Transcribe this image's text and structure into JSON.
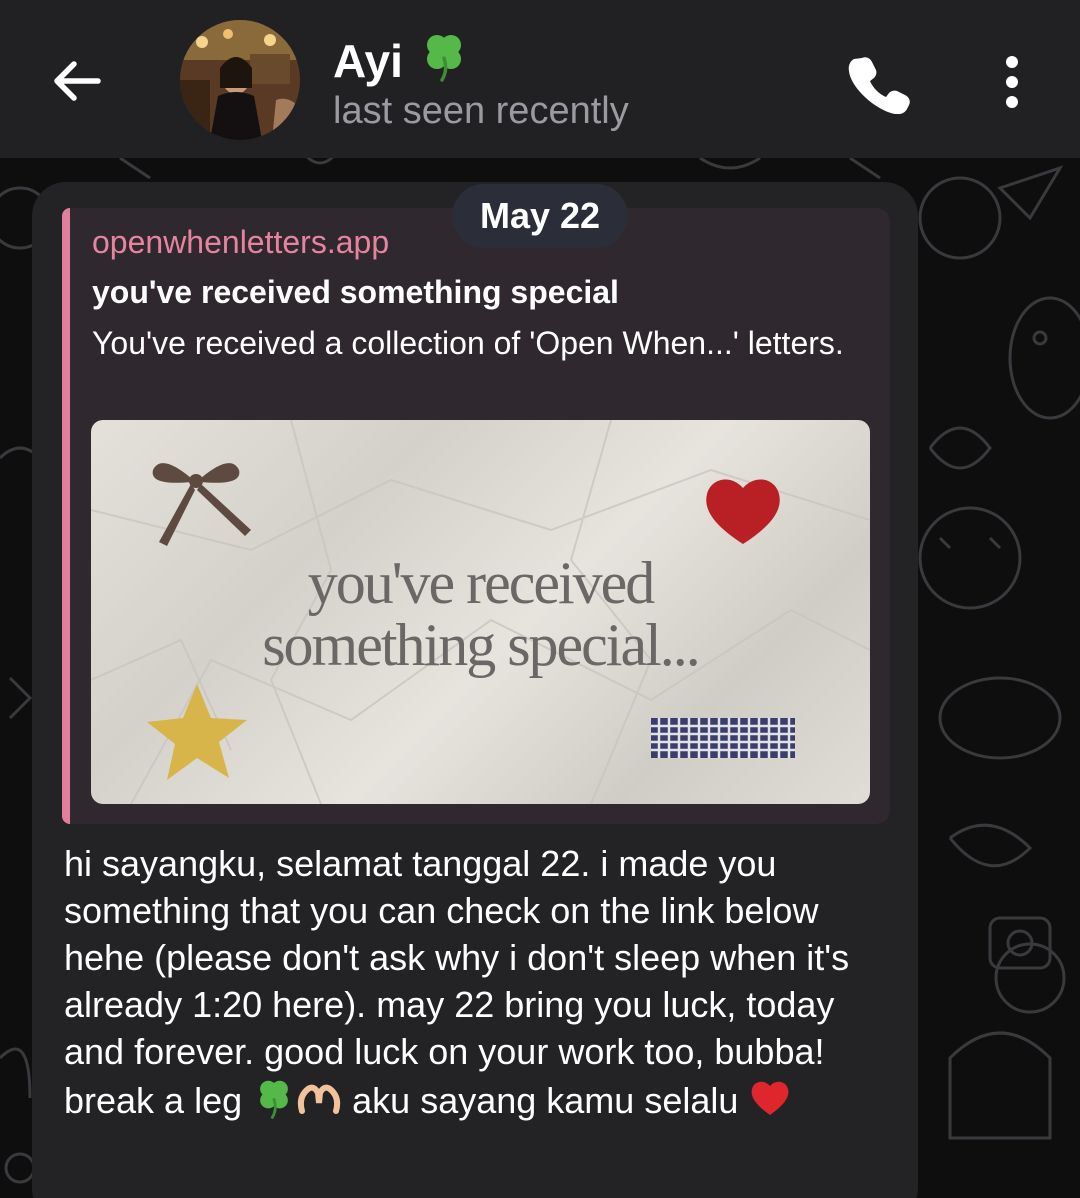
{
  "header": {
    "contact_name": "Ayi",
    "status": "last seen recently",
    "name_emoji": "four-leaf-clover-icon"
  },
  "date_separator": "May 22",
  "message": {
    "link_preview": {
      "site": "openwhenletters.app",
      "title": "you've received something special",
      "description": "You've received a collection of 'Open When...' letters.",
      "image_text": "you've received\nsomething special..."
    },
    "text": "hi sayangku, selamat tanggal 22. i made you something that you can check on the link below hehe (please don't ask why i don't sleep when it's already 1:20 here). may 22 bring you luck, today and forever. good luck on your work too, bubba! break a leg",
    "text_tail": "aku sayang kamu selalu",
    "emojis": [
      "four-leaf-clover-icon",
      "heart-hands-icon",
      "red-heart-icon"
    ]
  },
  "colors": {
    "header_bg": "#212124",
    "bubble_bg": "#232326",
    "preview_bg": "#2f282e",
    "accent_pink": "#e07f9c"
  }
}
